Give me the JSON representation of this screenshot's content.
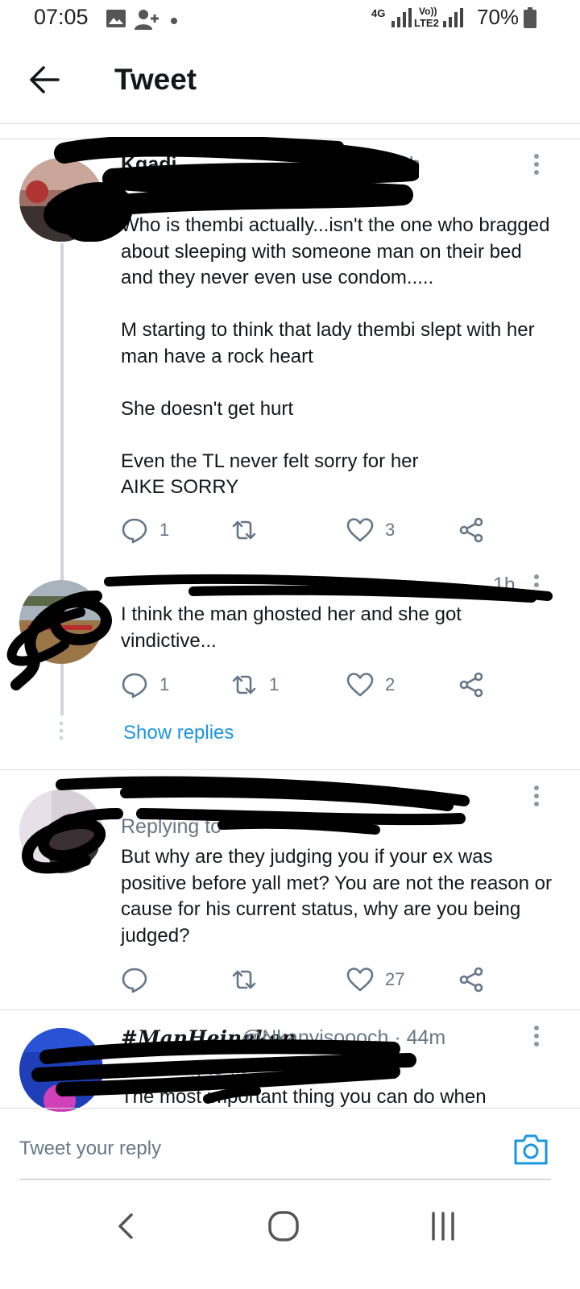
{
  "status_bar": {
    "time": "07:05",
    "network_4g": "4G",
    "volte": "Vo))",
    "lte2": "LTE2",
    "battery": "70%",
    "icons": [
      "gallery-icon",
      "person-add-icon",
      "dot-icon",
      "signal-icon",
      "battery-icon"
    ]
  },
  "header": {
    "title": "Tweet",
    "back_icon": "arrow-left-icon"
  },
  "tweets": [
    {
      "author_partial": "Kgadi",
      "meta_partial": "kgadi · 1h",
      "paragraphs": [
        "Who is thembi actually...isn't the one who bragged about sleeping with someone man on their bed and they never even use condom.....",
        "M starting to think that lady thembi slept with her man have a rock heart",
        "She doesn't get hurt",
        "Even the TL never felt sorry for her\nAIKE SORRY"
      ],
      "replies": "1",
      "retweets": "",
      "likes": "3"
    },
    {
      "meta_partial": "1h",
      "paragraphs": [
        "I think the man ghosted her and she got vindictive..."
      ],
      "replies": "1",
      "retweets": "1",
      "likes": "2"
    },
    {
      "replying_to": "Replying to",
      "paragraphs": [
        "But why are they judging you if your ex was positive before yall met? You are not the reason or cause for his current status, why are you being judged?"
      ],
      "replies": "",
      "retweets": "",
      "likes": "27"
    },
    {
      "author": "#ManHeineken",
      "handle_time": "@Nkanyisoooch · 44m",
      "replying_to_partial": "g to @",
      "paragraphs": [
        "The most important thing you can do when"
      ]
    }
  ],
  "show_replies": "Show replies",
  "reply_bar": {
    "placeholder": "Tweet your reply",
    "camera_icon": "camera-icon"
  },
  "colors": {
    "accent": "#1b95e0",
    "secondary_text": "#657786",
    "icon": "#657786",
    "divider": "#dddddd",
    "thread_line": "#cdd6dd"
  }
}
